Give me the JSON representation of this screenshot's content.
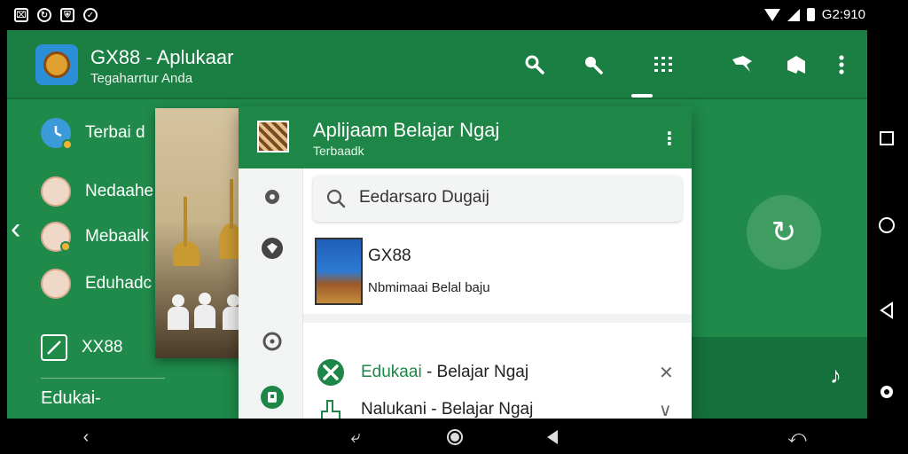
{
  "status_bar": {
    "time": "G2:910",
    "left_icons": [
      "image-icon",
      "sync-icon",
      "shield-icon",
      "check-icon"
    ]
  },
  "app": {
    "title": "GX88 - Aplukaar",
    "subtitle": "Tegaharrtur Anda",
    "header_icons": [
      "search-icon",
      "search-icon",
      "grid-icon",
      "flag-icon",
      "share-icon",
      "more-vertical-icon"
    ]
  },
  "left_list": {
    "items": [
      {
        "label": "Terbai  d",
        "icon": "clock-icon"
      },
      {
        "label": "Nedaahe",
        "icon": "avatar"
      },
      {
        "label": "Mebaalk",
        "icon": "avatar"
      },
      {
        "label": "Eduhadc",
        "icon": "avatar"
      },
      {
        "label": "XX88",
        "icon": "edit-icon"
      }
    ],
    "bottom_label": "Edukai‐"
  },
  "dialog": {
    "title": "Aplijaam Belajar Ngaj",
    "subtitle": "Terbaadk",
    "search": {
      "value": "Eedarsaro Dugaij"
    },
    "result": {
      "title": "GX88",
      "subtitle": "Nbmimaai Belal baju"
    },
    "options": [
      {
        "prefix": "Edukaai",
        "rest": " - Belajar Ngaj",
        "action": "✕",
        "icon": "tools-icon"
      },
      {
        "prefix": "",
        "rest": "Nalukani - Belajar Ngaj",
        "action": "∨",
        "icon": "hand-icon"
      }
    ],
    "rail_icons": [
      "gear-icon",
      "globe-icon",
      "location-icon",
      "account-icon"
    ]
  },
  "nav_bar": {
    "buttons": [
      "back-icon",
      "rotate-icon",
      "home-icon",
      "play-icon",
      "return-icon"
    ]
  },
  "colors": {
    "primary": "#1f8a4a",
    "header": "#1b7f44",
    "accent_text": "#1e8647"
  }
}
